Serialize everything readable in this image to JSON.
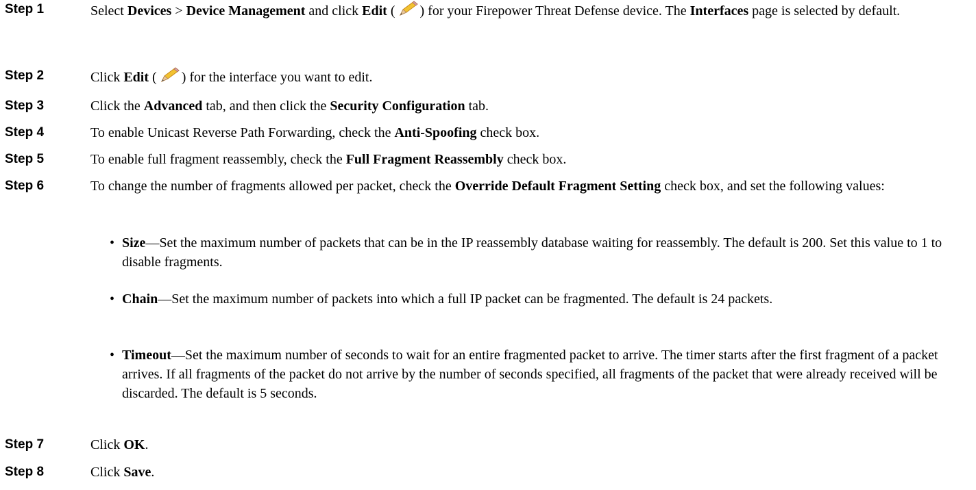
{
  "steps": [
    {
      "label": "Step 1",
      "t1": "Select ",
      "b1": "Devices",
      "t2": " > ",
      "b2": "Device Management",
      "t3": " and click ",
      "b3": "Edit",
      "t4": " (",
      "icon": "edit-pencil-icon",
      "t5": ") for your Firepower Threat Defense device. The ",
      "b4": "Interfaces",
      "t6": " page is selected by default."
    },
    {
      "label": "Step 2",
      "t1": "Click ",
      "b1": "Edit",
      "t2": " (",
      "icon": "edit-pencil-icon",
      "t3": ") for the interface you want to edit."
    },
    {
      "label": "Step 3",
      "t1": "Click the ",
      "b1": "Advanced",
      "t2": " tab, and then click the ",
      "b2": "Security Configuration",
      "t3": " tab."
    },
    {
      "label": "Step 4",
      "t1": "To enable Unicast Reverse Path Forwarding, check the ",
      "b1": "Anti-Spoofing",
      "t2": " check box."
    },
    {
      "label": "Step 5",
      "t1": "To enable full fragment reassembly, check the ",
      "b1": "Full Fragment Reassembly",
      "t2": " check box."
    },
    {
      "label": "Step 6",
      "t1": "To change the number of fragments allowed per packet, check the ",
      "b1": "Override Default Fragment Setting",
      "t2": " check box, and set the following values:",
      "bullets": [
        {
          "bullet": "•",
          "term": "Size",
          "dash": "—",
          "text": "Set the maximum number of packets that can be in the IP reassembly database waiting for reassembly. The default is 200. Set this value to 1 to disable fragments."
        },
        {
          "bullet": "•",
          "term": "Chain",
          "dash": "—",
          "text": "Set the maximum number of packets into which a full IP packet can be fragmented. The default is 24 packets."
        },
        {
          "bullet": "•",
          "term": "Timeout",
          "dash": "—",
          "text": "Set the maximum number of seconds to wait for an entire fragmented packet to arrive. The timer starts after the first fragment of a packet arrives. If all fragments of the packet do not arrive by the number of seconds specified, all fragments of the packet that were already received will be discarded. The default is 5 seconds."
        }
      ]
    },
    {
      "label": "Step 7",
      "t1": "Click ",
      "b1": "OK",
      "t2": "."
    },
    {
      "label": "Step 8",
      "t1": "Click ",
      "b1": "Save",
      "t2": "."
    }
  ],
  "colors": {
    "text": "#000000",
    "background": "#ffffff",
    "pencil_body": "#f2c230",
    "pencil_tip": "#e8c79a"
  }
}
